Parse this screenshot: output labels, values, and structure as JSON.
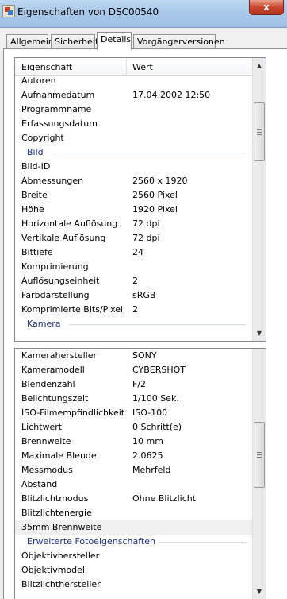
{
  "window": {
    "title": "Eigenschaften von DSC00540",
    "close_label": "x"
  },
  "tabs": [
    {
      "label": "Allgemein",
      "active": false
    },
    {
      "label": "Sicherheit",
      "active": false
    },
    {
      "label": "Details",
      "active": true
    },
    {
      "label": "Vorgängerversionen",
      "active": false
    }
  ],
  "list1": {
    "header": {
      "name": "Eigenschaft",
      "value": "Wert"
    },
    "rows": [
      {
        "name": "Autoren",
        "value": ""
      },
      {
        "name": "Aufnahmedatum",
        "value": "17.04.2002 12:50"
      },
      {
        "name": "Programmname",
        "value": ""
      },
      {
        "name": "Erfassungsdatum",
        "value": ""
      },
      {
        "name": "Copyright",
        "value": ""
      },
      {
        "group": "Bild"
      },
      {
        "name": "Bild-ID",
        "value": ""
      },
      {
        "name": "Abmessungen",
        "value": "2560 x 1920"
      },
      {
        "name": "Breite",
        "value": "2560 Pixel"
      },
      {
        "name": "Höhe",
        "value": "1920 Pixel"
      },
      {
        "name": "Horizontale Auflösung",
        "value": "72 dpi"
      },
      {
        "name": "Vertikale Auflösung",
        "value": "72 dpi"
      },
      {
        "name": "Bittiefe",
        "value": "24"
      },
      {
        "name": "Komprimierung",
        "value": ""
      },
      {
        "name": "Auflösungseinheit",
        "value": "2"
      },
      {
        "name": "Farbdarstellung",
        "value": "sRGB"
      },
      {
        "name": "Komprimierte Bits/Pixel",
        "value": "2"
      },
      {
        "group": "Kamera"
      }
    ]
  },
  "list2": {
    "rows": [
      {
        "name": "Kamerahersteller",
        "value": "SONY"
      },
      {
        "name": "Kameramodell",
        "value": "CYBERSHOT"
      },
      {
        "name": "Blendenzahl",
        "value": "F/2"
      },
      {
        "name": "Belichtungszeit",
        "value": "1/100 Sek."
      },
      {
        "name": "ISO-Filmempfindlichkeit",
        "value": "ISO-100"
      },
      {
        "name": "Lichtwert",
        "value": "0 Schritt(e)"
      },
      {
        "name": "Brennweite",
        "value": "10 mm"
      },
      {
        "name": "Maximale Blende",
        "value": "2.0625"
      },
      {
        "name": "Messmodus",
        "value": "Mehrfeld"
      },
      {
        "name": "Abstand",
        "value": ""
      },
      {
        "name": "Blitzlichtmodus",
        "value": "Ohne Blitzlicht"
      },
      {
        "name": "Blitzlichtenergie",
        "value": ""
      },
      {
        "name": "35mm Brennweite",
        "value": "",
        "selected": true
      },
      {
        "group": "Erweiterte Fotoeigenschaften"
      },
      {
        "name": "Objektivhersteller",
        "value": ""
      },
      {
        "name": "Objektivmodell",
        "value": ""
      },
      {
        "name": "Blitzlichthersteller",
        "value": ""
      }
    ]
  },
  "icons": {
    "window": "image-file-icon",
    "scroll_up": "arrow-up-icon",
    "scroll_down": "arrow-down-icon"
  }
}
